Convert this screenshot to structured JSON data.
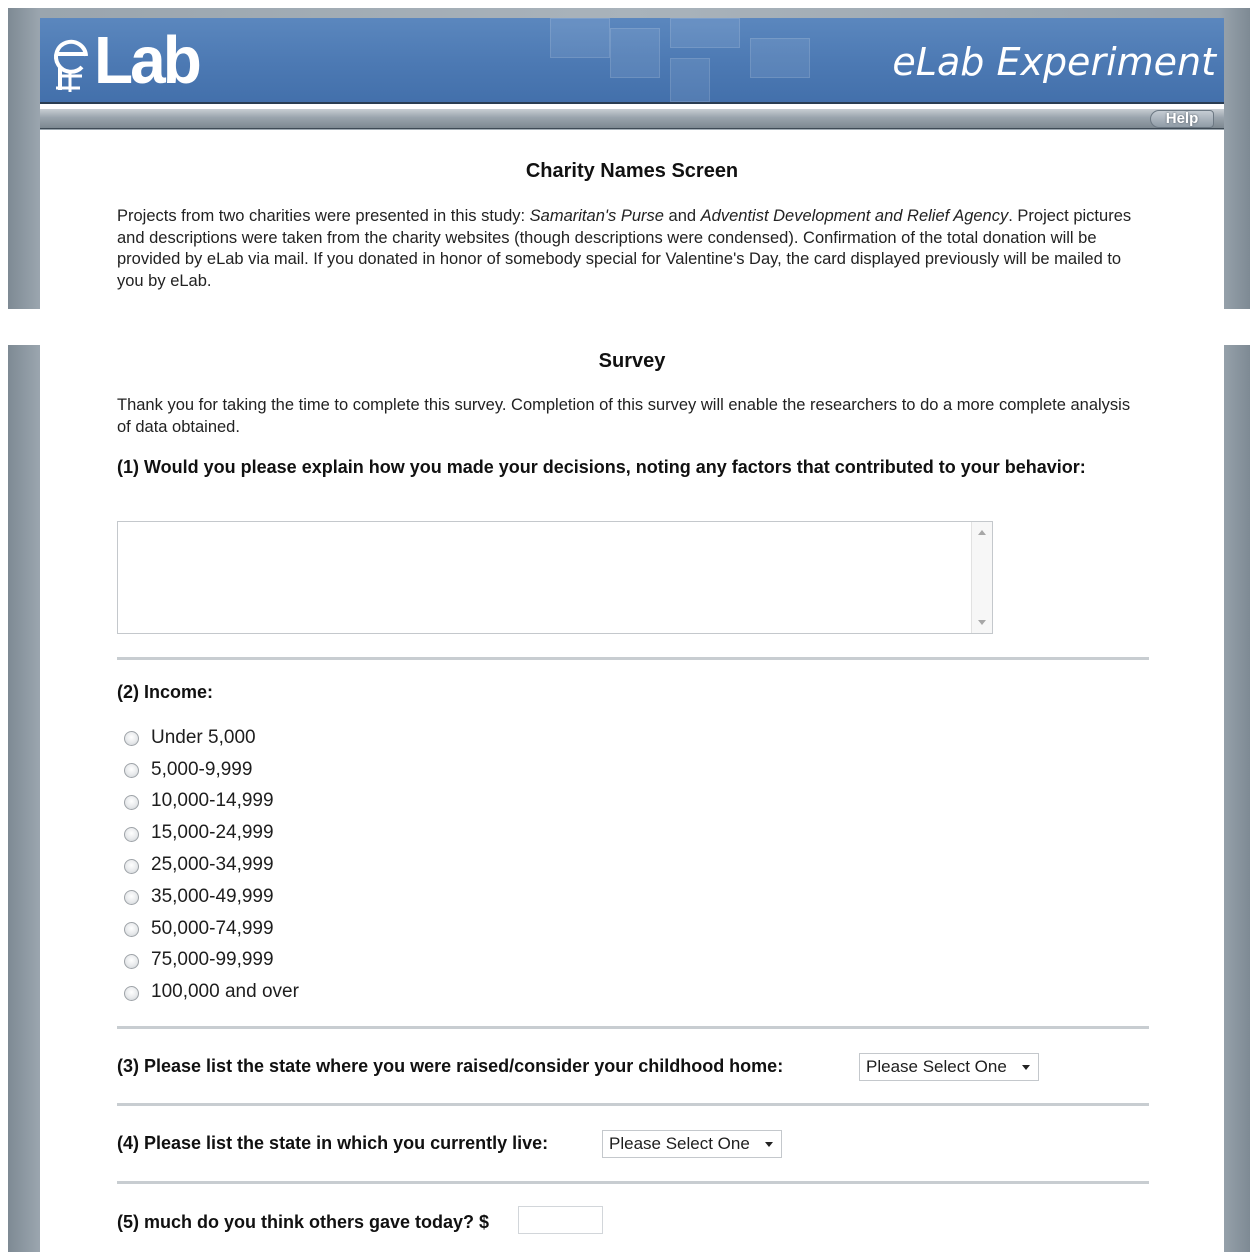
{
  "header": {
    "logo_text": "Lab",
    "experiment_title": "eLab Experiment",
    "help_label": "Help"
  },
  "charity": {
    "heading": "Charity Names Screen",
    "paragraph_part1": "Projects from two charities were presented in this study: ",
    "charity1": "Samaritan's Purse",
    "and": " and ",
    "charity2": "Adventist Development and Relief Agency",
    "paragraph_part2": ". Project pictures and descriptions were taken from the charity websites (though descriptions were condensed). Confirmation of the total donation will be provided by eLab via mail. If you donated in honor of somebody special for Valentine's Day, the card displayed previously will be mailed to you by eLab."
  },
  "survey": {
    "heading": "Survey",
    "intro": "Thank you for taking the time to complete this survey. Completion of this survey will enable the researchers to do a more complete analysis of data obtained.",
    "q1": {
      "label": "(1) Would you please explain how you made your decisions, noting any factors that contributed to your behavior:",
      "value": ""
    },
    "q2": {
      "label": "(2) Income:",
      "options": [
        "Under 5,000",
        "5,000-9,999",
        "10,000-14,999",
        "15,000-24,999",
        "25,000-34,999",
        "35,000-49,999",
        "50,000-74,999",
        "75,000-99,999",
        "100,000 and over"
      ]
    },
    "q3": {
      "label": "(3) Please list the state where you were raised/consider your childhood home:",
      "selected": "Please Select One"
    },
    "q4": {
      "label": "(4) Please list the state in which you currently live:",
      "selected": "Please Select One"
    },
    "q5": {
      "label": "(5) much do you think others gave today? $",
      "value": ""
    }
  },
  "colors": {
    "banner_blue": "#4c79b3",
    "frame_gray": "#a9b3bb",
    "divider_gray": "#c8cdd1"
  }
}
